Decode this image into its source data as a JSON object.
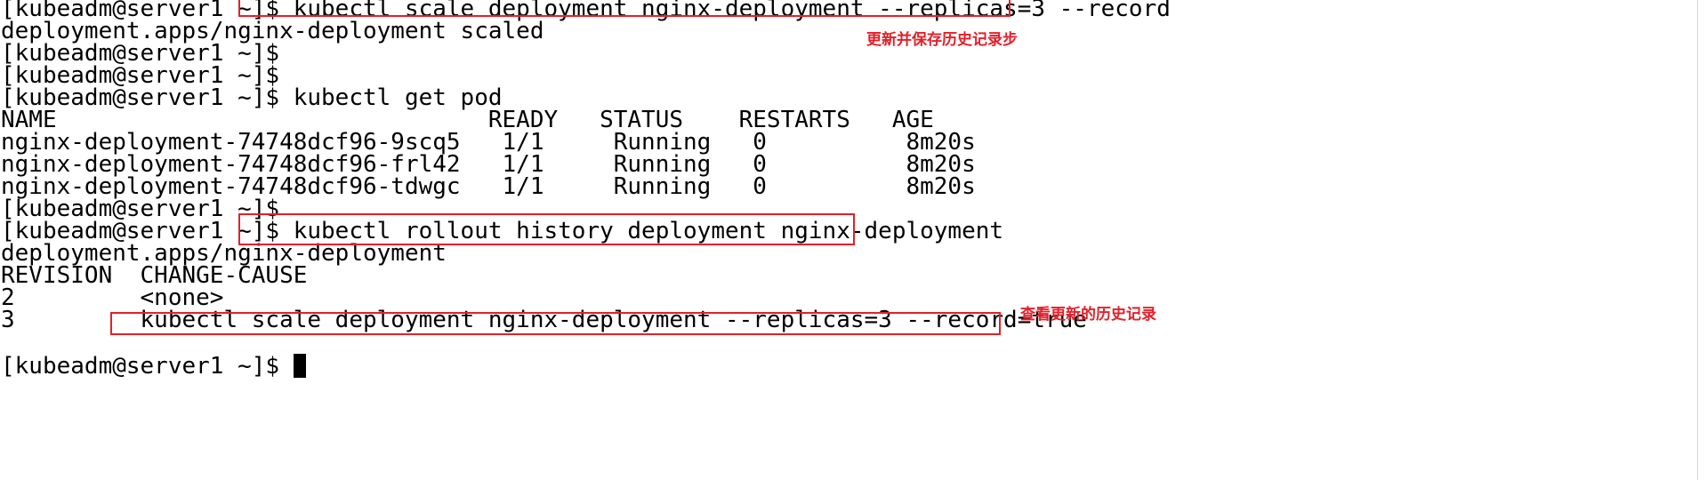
{
  "terminal": {
    "lines": [
      "[kubeadm@server1 ~]$ kubectl scale deployment nginx-deployment --replicas=3 --record",
      "deployment.apps/nginx-deployment scaled",
      "[kubeadm@server1 ~]$",
      "[kubeadm@server1 ~]$",
      "[kubeadm@server1 ~]$ kubectl get pod",
      "NAME                               READY   STATUS    RESTARTS   AGE",
      "nginx-deployment-74748dcf96-9scq5   1/1     Running   0          8m20s",
      "nginx-deployment-74748dcf96-frl42   1/1     Running   0          8m20s",
      "nginx-deployment-74748dcf96-tdwgc   1/1     Running   0          8m20s",
      "[kubeadm@server1 ~]$",
      "[kubeadm@server1 ~]$ kubectl rollout history deployment nginx-deployment",
      "deployment.apps/nginx-deployment",
      "REVISION  CHANGE-CAUSE",
      "2         <none>",
      "3         kubectl scale deployment nginx-deployment --replicas=3 --record=true",
      "",
      "[kubeadm@server1 ~]$ "
    ]
  },
  "annotations": {
    "note_record": "更新并保存历史记录步",
    "note_history": "查看更新的历史记录"
  },
  "colors": {
    "terminal_bg": "#ffffff",
    "terminal_text": "#000000",
    "annotation_red": "#e3202a"
  }
}
